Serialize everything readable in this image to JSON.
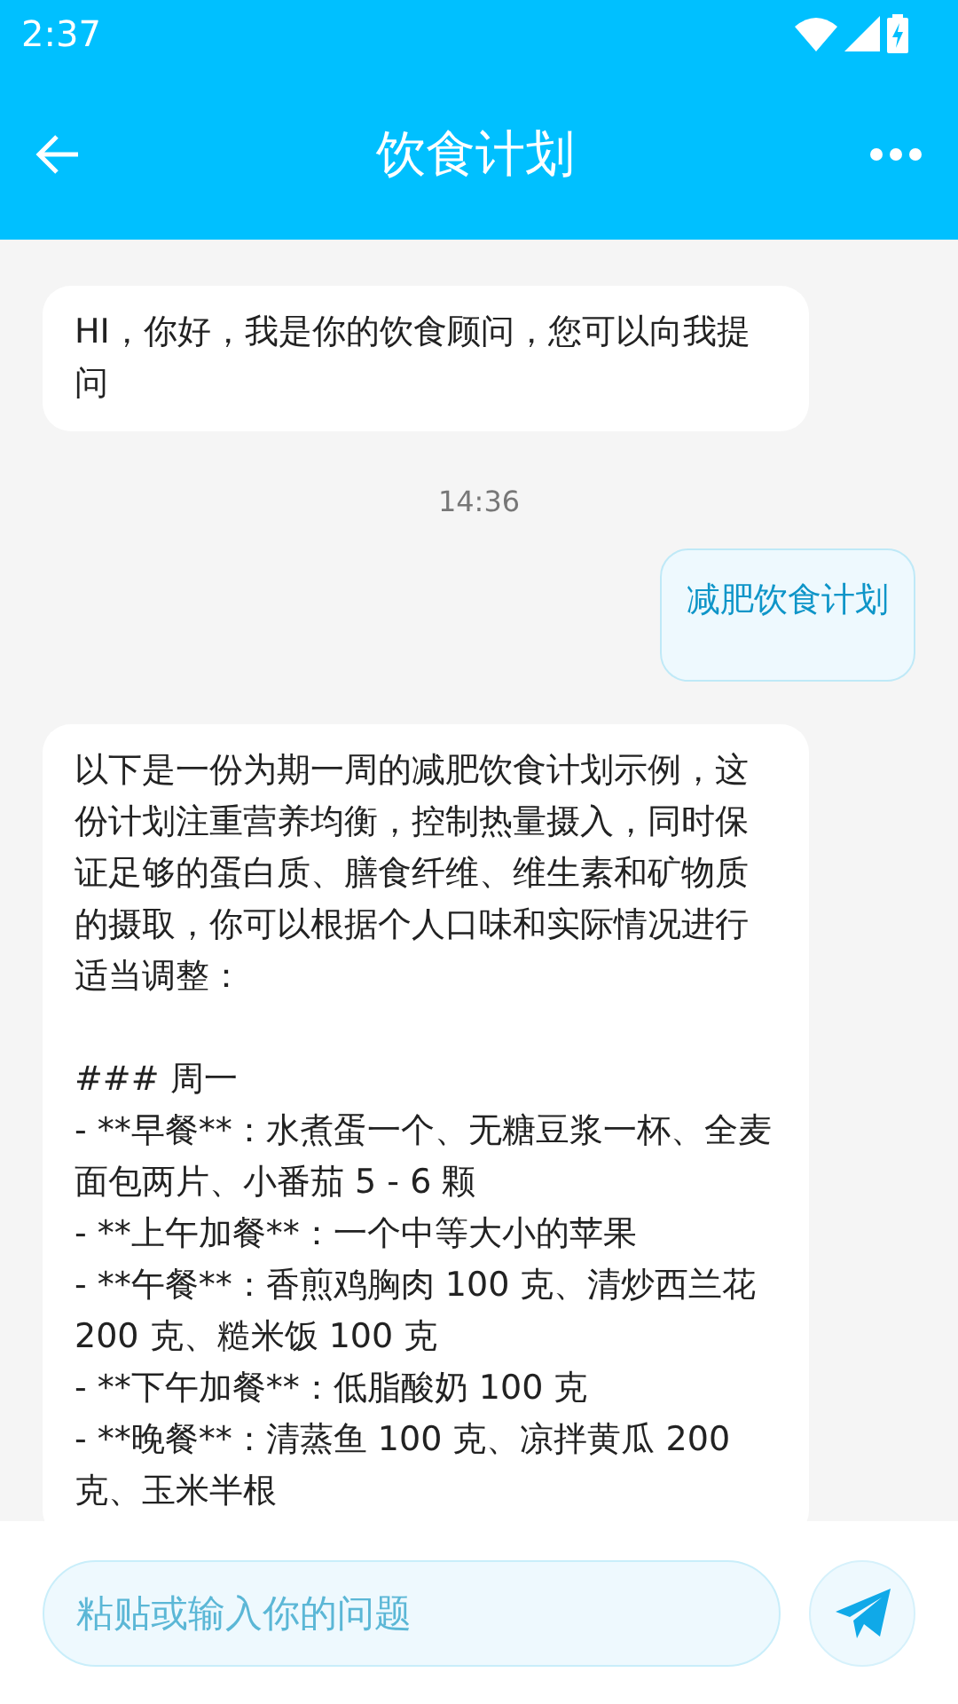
{
  "status_bar": {
    "time": "2:37"
  },
  "app_bar": {
    "title": "饮食计划"
  },
  "messages": [
    {
      "kind": "bot",
      "text": "HI，你好，我是你的饮食顾问，您可以向我提问"
    },
    {
      "kind": "time",
      "text": "14:36"
    },
    {
      "kind": "user",
      "text": "减肥饮食计划"
    },
    {
      "kind": "bot",
      "text": "以下是一份为期一周的减肥饮食计划示例，这份计划注重营养均衡，控制热量摄入，同时保证足够的蛋白质、膳食纤维、维生素和矿物质的摄取，你可以根据个人口味和实际情况进行适当调整：\n\n### 周一\n- **早餐**：水煮蛋一个、无糖豆浆一杯、全麦面包两片、小番茄 5 - 6 颗\n- **上午加餐**：一个中等大小的苹果\n- **午餐**：香煎鸡胸肉 100 克、清炒西兰花 200 克、糙米饭 100 克\n- **下午加餐**：低脂酸奶 100 克\n- **晚餐**：清蒸鱼 100 克、凉拌黄瓜 200 克、玉米半根"
    }
  ],
  "input": {
    "placeholder": "粘贴或输入你的问题"
  }
}
